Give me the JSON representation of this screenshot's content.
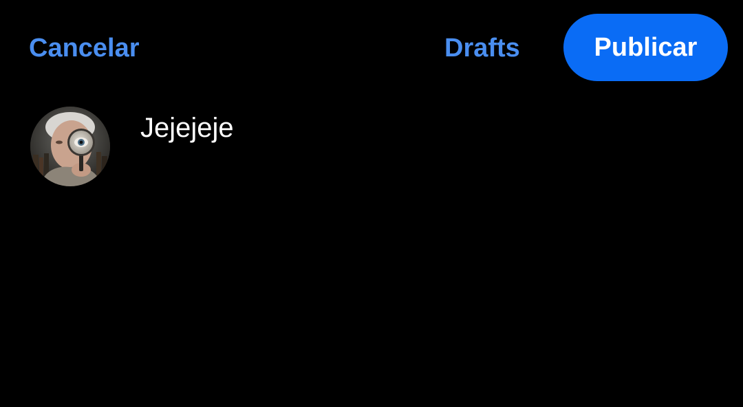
{
  "header": {
    "cancel_label": "Cancelar",
    "drafts_label": "Drafts",
    "publish_label": "Publicar"
  },
  "composer": {
    "text": "Jejejeje",
    "avatar_icon": "user-avatar-photo"
  },
  "colors": {
    "background": "#000000",
    "link": "#4a8ef0",
    "publish_button": "#0a6cf5",
    "text": "#ffffff"
  }
}
